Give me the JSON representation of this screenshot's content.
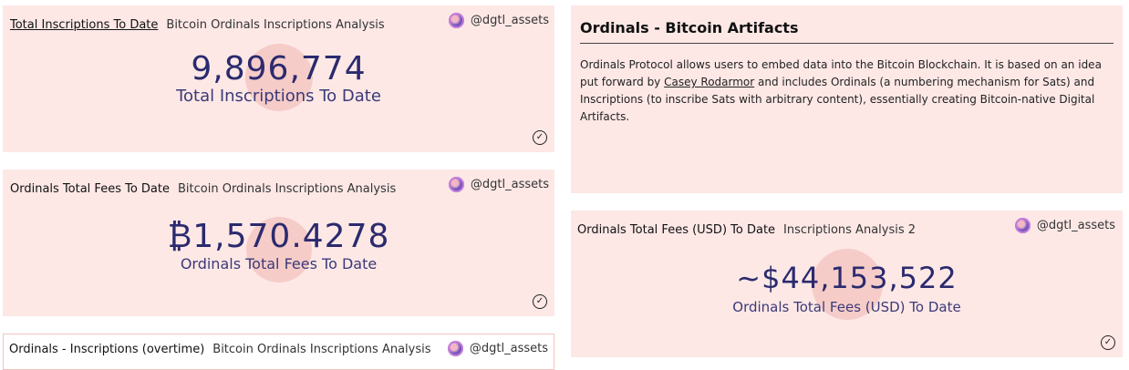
{
  "cards": {
    "total_inscriptions": {
      "title": "Total Inscriptions To Date",
      "subtitle": "Bitcoin Ordinals Inscriptions Analysis",
      "owner": "@dgtl_assets",
      "value": "9,896,774",
      "label": "Total Inscriptions To Date"
    },
    "total_fees": {
      "title": "Ordinals Total Fees To Date",
      "subtitle": "Bitcoin Ordinals Inscriptions Analysis",
      "owner": "@dgtl_assets",
      "value": "₿1,570.4278",
      "label": "Ordinals Total Fees To Date"
    },
    "inscriptions_overtime": {
      "title": "Ordinals - Inscriptions (overtime)",
      "subtitle": "Bitcoin Ordinals Inscriptions Analysis",
      "owner": "@dgtl_assets"
    },
    "total_fees_usd": {
      "title": "Ordinals Total Fees (USD) To Date",
      "subtitle": "Inscriptions Analysis 2",
      "owner": "@dgtl_assets",
      "value": "~$44,153,522",
      "label": "Ordinals Total Fees (USD) To Date"
    }
  },
  "text_card": {
    "heading": "Ordinals - Bitcoin Artifacts",
    "body_part1": "Ordinals Protocol allows users to embed data into the Bitcoin Blockchain. It is based on an idea put forward by ",
    "link_text": "Casey Rodarmor",
    "body_part2": " and includes Ordinals (a numbering mechanism for Sats) and Inscriptions (to inscribe Sats with arbitrary content), essentially creating Bitcoin-native Digital Artifacts."
  },
  "icons": {
    "check": "✓"
  },
  "colors": {
    "card_bg": "#fde8e6",
    "metric_text": "#2b2a6e"
  }
}
